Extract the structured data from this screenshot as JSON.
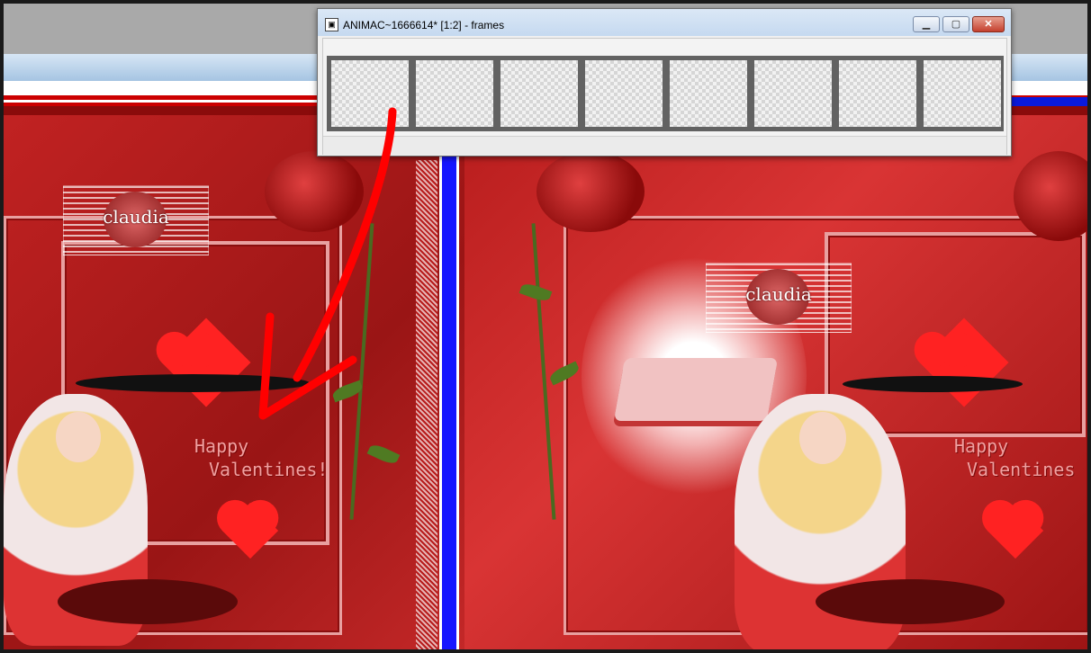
{
  "window": {
    "title": "ANIMAC~1666614* [1:2] - frames",
    "icon": "document-icon",
    "min_glyph": "▁",
    "max_glyph": "▢",
    "close_glyph": "✕",
    "frame_count": 8
  },
  "artwork": {
    "watermark_text": "claudia",
    "greeting_line1": "Happy",
    "greeting_line2": "Valentines!",
    "greeting_line2_right": "Valentines",
    "accent_red": "#cc1a1a",
    "accent_blue": "#1515ff",
    "arrow_color": "#ff0000"
  }
}
